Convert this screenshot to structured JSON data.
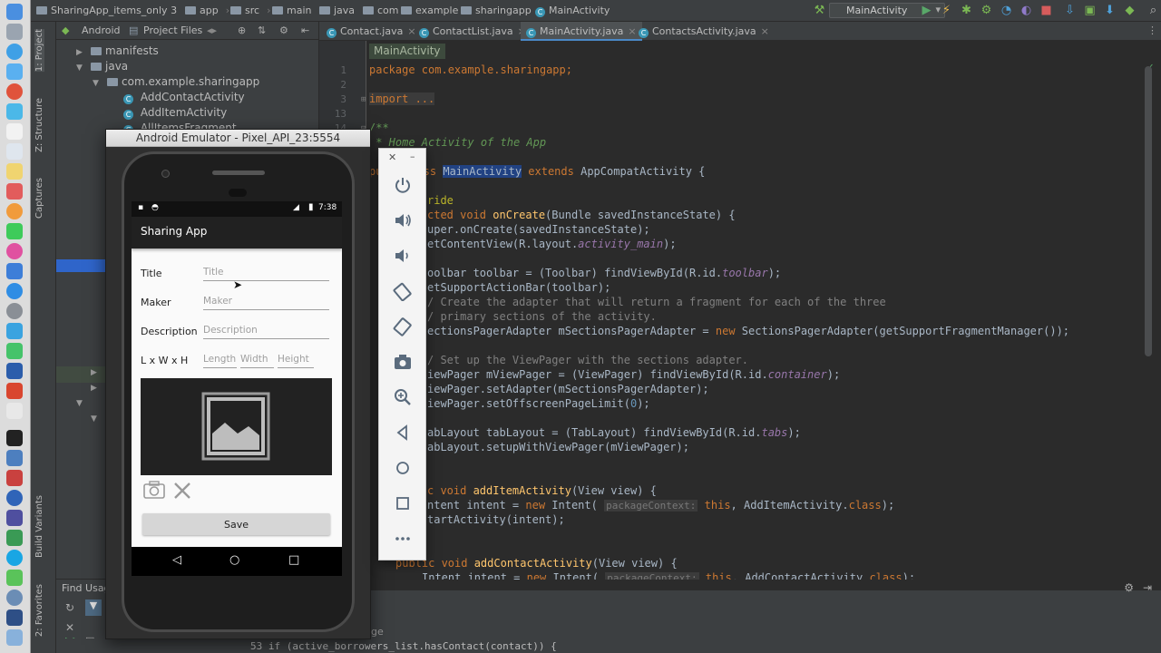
{
  "navbar": {
    "crumbs": [
      "SharingApp_items_only 3",
      "app",
      "src",
      "main",
      "java",
      "com",
      "example",
      "sharingapp",
      "MainActivity"
    ],
    "run_config": "MainActivity"
  },
  "tool_windows": {
    "project": "1: Project",
    "structure": "Z: Structure",
    "captures": "Captures",
    "build_variants": "Build Variants",
    "favorites": "2: Favorites"
  },
  "project": {
    "view_mode": "Android",
    "project_files": "Project Files",
    "tree": [
      "manifests",
      "java",
      "com.example.sharingapp",
      "AddContactActivity",
      "AddItemActivity",
      "AllItemsFragment"
    ],
    "find_usages": "Find Usag"
  },
  "editor_tabs": [
    "Contact.java",
    "ContactList.java",
    "MainActivity.java",
    "ContactsActivity.java"
  ],
  "editor": {
    "breadcrumb": "MainActivity",
    "line_numbers": [
      "1",
      "2",
      "3",
      "13",
      "14"
    ],
    "code": [
      "package com.example.sharingapp;",
      "import ...",
      "/**",
      " * Home Activity of the App",
      "pu",
      "ass ",
      "MainActivity",
      " extends ",
      "AppCompatActivity {",
      "ride",
      "cted void ",
      "onCreate",
      "(Bundle savedInstanceState) {",
      "uper.onCreate(savedInstanceState);",
      "etContentView(R.layout.",
      "activity_main",
      ");",
      "oolbar toolbar = (Toolbar) findViewById(R.id.",
      "toolbar",
      ");",
      "etSupportActionBar(toolbar);",
      "/ Create the adapter that will return a fragment for each of the three",
      "/ primary sections of the activity.",
      "ectionsPagerAdapter mSectionsPagerAdapter = ",
      "new ",
      "SectionsPagerAdapter(getSupportFragmentManager());",
      "/ Set up the ViewPager with the sections adapter.",
      "iewPager mViewPager = (ViewPager) findViewById(R.id.",
      "container",
      ");",
      "iewPager.setAdapter(mSectionsPagerAdapter);",
      "iewPager.setOffscreenPageLimit(",
      "0",
      ");",
      "abLayout tabLayout = (TabLayout) findViewById(R.id.",
      "tabs",
      ");",
      "abLayout.setupWithViewPager(mViewPager);",
      "c void ",
      "addItemActivity",
      "(View view) {",
      "ntent intent = ",
      "new ",
      "Intent( ",
      "packageContext:",
      " this",
      ", AddItemActivity.",
      "class",
      ");",
      "tartActivity(intent);",
      "public void ",
      "addContactActivity",
      "(View view) {",
      "Intent intent = ",
      "new ",
      "Intent( ",
      "packageContext:",
      " this",
      ", AddContactActivity.",
      "class",
      ");"
    ],
    "status_line": "53 if (active_borrowers_list.hasContact(contact)) {",
    "bottom_hint": "ge"
  },
  "emulator": {
    "title": "Android Emulator - Pixel_API_23:5554",
    "time": "7:38",
    "app_title": "Sharing App",
    "fields": {
      "title_label": "Title",
      "title_placeholder": "Title",
      "maker_label": "Maker",
      "maker_placeholder": "Maker",
      "description_label": "Description",
      "description_placeholder": "Description",
      "dimensions_label": "L x W x H",
      "length_placeholder": "Length",
      "width_placeholder": "Width",
      "height_placeholder": "Height"
    },
    "save_label": "Save"
  },
  "colors": {
    "ide_bg": "#2b2b2b",
    "ide_panel": "#3c3f41",
    "keyword": "#cc7832",
    "method": "#ffc66d",
    "app_bar": "#212121"
  }
}
